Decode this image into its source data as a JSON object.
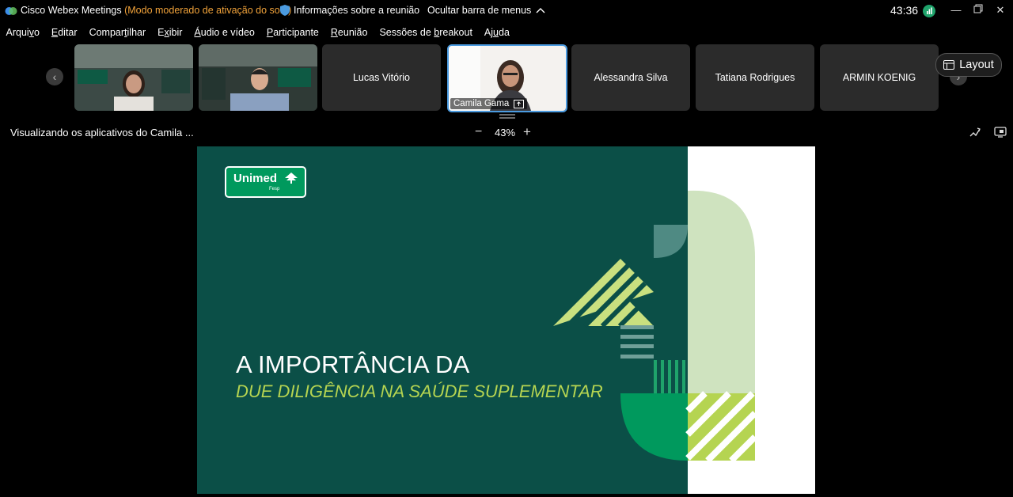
{
  "titlebar": {
    "app_name": "Cisco Webex Meetings",
    "mode": "(Modo moderado de ativação do som)",
    "meeting_info": "Informações sobre a reunião",
    "hide_menu": "Ocultar barra de menus",
    "timer": "43:36"
  },
  "menu": {
    "items": [
      {
        "pre": "Arqui",
        "u": "v",
        "post": "o"
      },
      {
        "pre": "",
        "u": "E",
        "post": "ditar"
      },
      {
        "pre": "Compar",
        "u": "t",
        "post": "ilhar"
      },
      {
        "pre": "E",
        "u": "x",
        "post": "ibir"
      },
      {
        "pre": "",
        "u": "Á",
        "post": "udio e vídeo"
      },
      {
        "pre": "",
        "u": "P",
        "post": "articipante"
      },
      {
        "pre": "",
        "u": "R",
        "post": "eunião"
      },
      {
        "pre": "Sessões de ",
        "u": "b",
        "post": "reakout"
      },
      {
        "pre": "Aj",
        "u": "u",
        "post": "da"
      }
    ]
  },
  "participants": {
    "names": [
      "Lucas Vitório",
      "Camila Gama",
      "Alessandra Silva",
      "Tatiana Rodrigues",
      "ARMIN KOENIG"
    ]
  },
  "layout_button": "Layout",
  "share_toolbar": {
    "viewing": "Visualizando os aplicativos do Camila ...",
    "zoom": "43%"
  },
  "slide": {
    "logo_name": "Unimed",
    "logo_sub": "Fesp",
    "title": "A IMPORTÂNCIA DA",
    "subtitle": "DUE DILIGÊNCIA NA SAÚDE SUPLEMENTAR"
  },
  "colors": {
    "slide_bg": "#0b4f47",
    "accent_lime": "#b5d451",
    "accent_green": "#00995d",
    "mode_text": "#f2a33a",
    "active_border": "#4b9be0"
  }
}
